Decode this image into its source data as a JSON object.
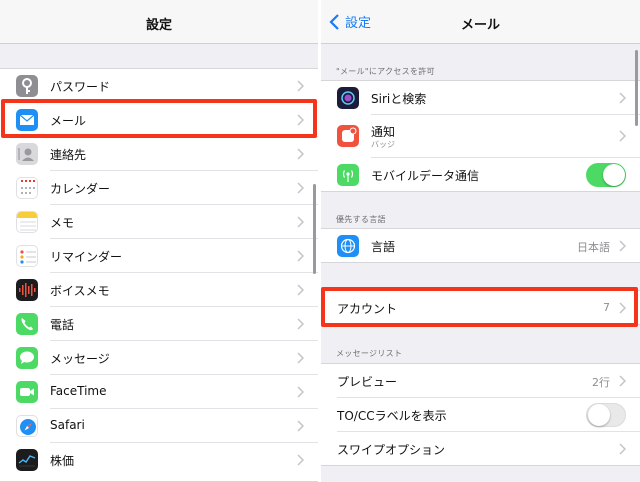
{
  "colors": {
    "accent": "#1a7cf5",
    "highlight": "#f5341c",
    "toggle_on": "#4cd964"
  },
  "left": {
    "title": "設定",
    "items": [
      {
        "label": "パスワード",
        "icon": "key-icon"
      },
      {
        "label": "メール",
        "icon": "mail-icon"
      },
      {
        "label": "連絡先",
        "icon": "contacts-icon"
      },
      {
        "label": "カレンダー",
        "icon": "calendar-icon"
      },
      {
        "label": "メモ",
        "icon": "notes-icon"
      },
      {
        "label": "リマインダー",
        "icon": "reminders-icon"
      },
      {
        "label": "ボイスメモ",
        "icon": "voice-memo-icon"
      },
      {
        "label": "電話",
        "icon": "phone-icon"
      },
      {
        "label": "メッセージ",
        "icon": "messages-icon"
      },
      {
        "label": "FaceTime",
        "icon": "facetime-icon"
      },
      {
        "label": "Safari",
        "icon": "safari-icon"
      },
      {
        "label": "株価",
        "icon": "stocks-icon"
      }
    ]
  },
  "right": {
    "back_label": "設定",
    "title": "メール",
    "section_access": "\"メール\"にアクセスを許可",
    "access_items": [
      {
        "label": "Siriと検索",
        "icon": "siri-icon"
      },
      {
        "label": "通知",
        "sublabel": "バッジ",
        "icon": "notifications-icon"
      },
      {
        "label": "モバイルデータ通信",
        "icon": "cellular-icon",
        "toggle": true
      }
    ],
    "section_language": "優先する言語",
    "language": {
      "label": "言語",
      "value": "日本語",
      "icon": "globe-icon"
    },
    "accounts": {
      "label": "アカウント",
      "value": "7"
    },
    "section_message_list": "メッセージリスト",
    "message_list": [
      {
        "label": "プレビュー",
        "value": "2行"
      },
      {
        "label": "TO/CCラベルを表示",
        "toggle": false
      },
      {
        "label": "スワイプオプション"
      }
    ]
  }
}
